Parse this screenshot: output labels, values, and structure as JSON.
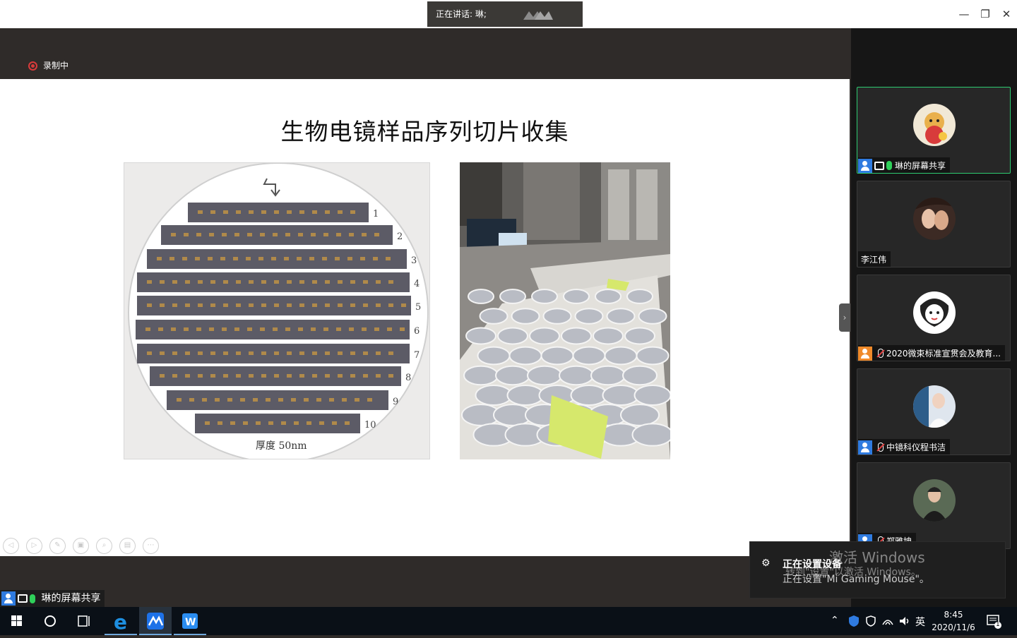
{
  "titlebar": {
    "speaker_text": "正在讲话: 琳;",
    "minimize_label": "—",
    "restore_label": "❐",
    "close_label": "✕"
  },
  "recording": {
    "label": "录制中"
  },
  "slide": {
    "title": "生物电镜样品序列切片收集",
    "wafer_numbers": [
      "1",
      "2",
      "3",
      "4",
      "5",
      "6",
      "7",
      "8",
      "9",
      "10"
    ],
    "wafer_caption": "厚度 50nm",
    "tools": [
      "◁",
      "▷",
      "✎",
      "▣",
      "⌕",
      "▤",
      "⋯"
    ]
  },
  "self_tile": {
    "label": "琳的屏幕共享"
  },
  "participants": [
    {
      "name": "琳的屏幕共享",
      "role": "host",
      "mic": "on",
      "screen": true,
      "active": true
    },
    {
      "name": "李江伟",
      "role": "none",
      "mic": "none",
      "screen": false,
      "active": false
    },
    {
      "name": "2020微束标准宣贯会及教育...",
      "role": "orange",
      "mic": "off",
      "screen": false,
      "active": false
    },
    {
      "name": "中镜科仪程书洁",
      "role": "host",
      "mic": "off",
      "screen": false,
      "active": false
    },
    {
      "name": "郑雅坤",
      "role": "host",
      "mic": "off",
      "screen": false,
      "active": false
    }
  ],
  "sidebar": {
    "collapse_label": "›"
  },
  "toast": {
    "icon": "gear-icon",
    "title": "正在设置设备",
    "body": "正在设置\"Mi Gaming Mouse\"。"
  },
  "watermark": {
    "line1": "激活 Windows",
    "line2": "转到\"设置\"以激活 Windows。"
  },
  "taskbar": {
    "ime": "英",
    "time": "8:45",
    "date": "2020/11/6",
    "notification_count": "1"
  },
  "colors": {
    "accent_green": "#2ecc71",
    "host_blue": "#2f7be0",
    "guest_orange": "#f08a2a",
    "record_red": "#d83b3b"
  }
}
